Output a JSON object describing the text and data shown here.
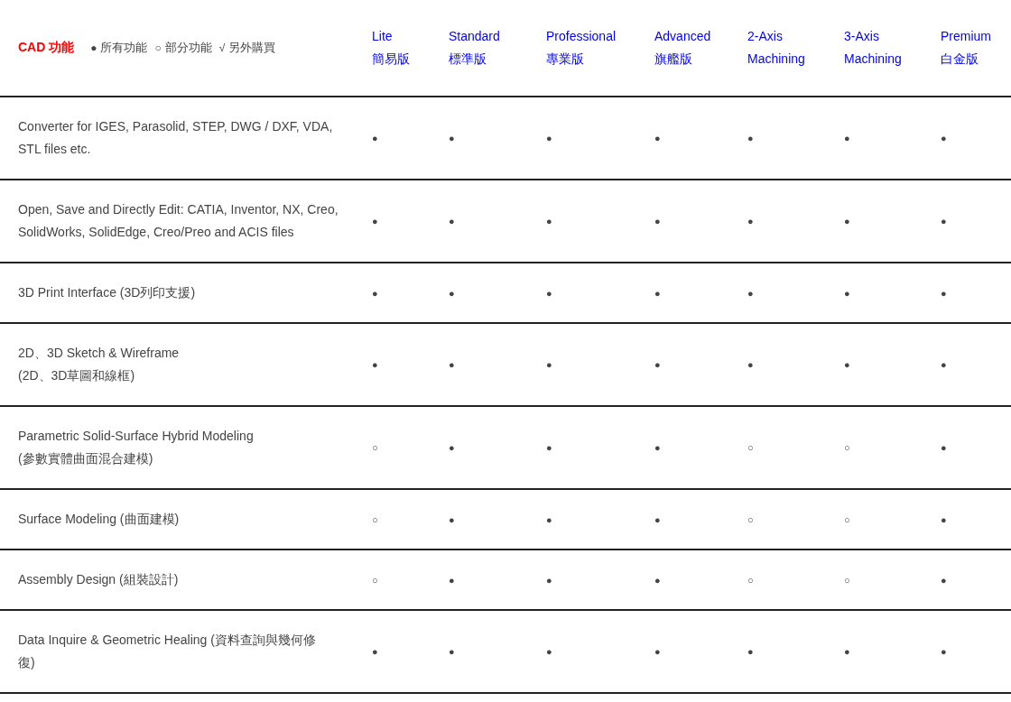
{
  "table": {
    "title": "CAD 功能",
    "legend": [
      {
        "symbol": "●",
        "label": "所有功能"
      },
      {
        "symbol": "○",
        "label": "部分功能"
      },
      {
        "symbol": "√",
        "label": "另外購買"
      }
    ],
    "columns": [
      {
        "name": "Lite",
        "subtitle": "簡易版"
      },
      {
        "name": "Standard",
        "subtitle": "標準版"
      },
      {
        "name": "Professional",
        "subtitle": "專業版"
      },
      {
        "name": "Advanced",
        "subtitle": "旗艦版"
      },
      {
        "name": "2-Axis",
        "subtitle": "Machining"
      },
      {
        "name": "3-Axis",
        "subtitle": "Machining"
      },
      {
        "name": "Premium",
        "subtitle": "白金版"
      }
    ],
    "rows": [
      {
        "feature": [
          "Converter for IGES, Parasolid, STEP, DWG / DXF, VDA,",
          "STL files etc."
        ],
        "cells": [
          "●",
          "●",
          "●",
          "●",
          "●",
          "●",
          "●"
        ]
      },
      {
        "feature": [
          "Open, Save and Directly Edit: CATIA, Inventor, NX, Creo,",
          "SolidWorks, SolidEdge, Creo/Preo and ACIS files"
        ],
        "cells": [
          "●",
          "●",
          "●",
          "●",
          "●",
          "●",
          "●"
        ]
      },
      {
        "feature": [
          "3D Print Interface (3D列印支援)"
        ],
        "cells": [
          "●",
          "●",
          "●",
          "●",
          "●",
          "●",
          "●"
        ]
      },
      {
        "feature": [
          "2D、3D Sketch & Wireframe",
          "(2D、3D草圖和線框)"
        ],
        "cells": [
          "●",
          "●",
          "●",
          "●",
          "●",
          "●",
          "●"
        ]
      },
      {
        "feature": [
          "Parametric Solid-Surface Hybrid Modeling",
          "(參數實體曲面混合建模)"
        ],
        "cells": [
          "○",
          "●",
          "●",
          "●",
          "○",
          "○",
          "●"
        ]
      },
      {
        "feature": [
          "Surface Modeling (曲面建模)"
        ],
        "cells": [
          "○",
          "●",
          "●",
          "●",
          "○",
          "○",
          "●"
        ]
      },
      {
        "feature": [
          "Assembly Design (組裝設計)"
        ],
        "cells": [
          "○",
          "●",
          "●",
          "●",
          "○",
          "○",
          "●"
        ]
      },
      {
        "feature": [
          "Data Inquire & Geometric Healing (資料查詢與幾何修",
          "復)"
        ],
        "cells": [
          "●",
          "●",
          "●",
          "●",
          "●",
          "●",
          "●"
        ]
      }
    ]
  }
}
